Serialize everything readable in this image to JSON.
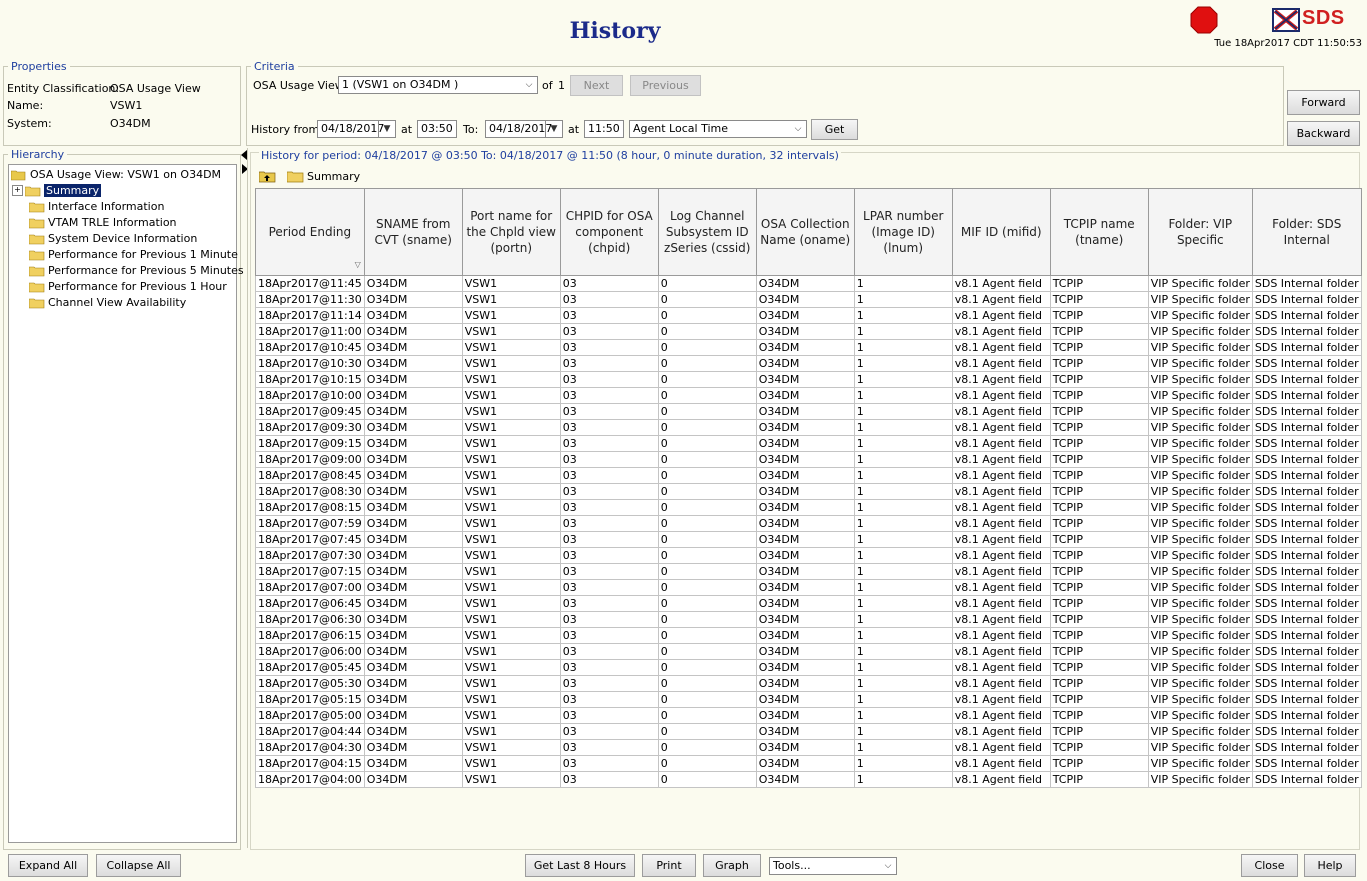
{
  "header": {
    "title": "History",
    "brand": "SDS",
    "datetime": "Tue 18Apr2017 CDT 11:50:53"
  },
  "properties": {
    "legend": "Properties",
    "rows": [
      {
        "label": "Entity Classification:",
        "value": "OSA Usage View"
      },
      {
        "label": "Name:",
        "value": "VSW1"
      },
      {
        "label": "System:",
        "value": "O34DM"
      }
    ]
  },
  "criteria": {
    "legend": "Criteria",
    "view_label": "OSA Usage View",
    "view_value": "1 (VSW1 on O34DM )",
    "of_label": "of",
    "of_count": "1",
    "next": "Next",
    "previous": "Previous",
    "history_from_label": "History from:",
    "from_date": "04/18/2017",
    "at1": "at",
    "from_time": "03:50",
    "to_label": "To:",
    "to_date": "04/18/2017",
    "at2": "at",
    "to_time": "11:50",
    "timezone": "Agent Local Time",
    "get": "Get"
  },
  "nav": {
    "forward": "Forward",
    "backward": "Backward"
  },
  "hierarchy": {
    "legend": "Hierarchy",
    "root": "OSA Usage View: VSW1 on O34DM",
    "items": [
      "Summary",
      "Interface Information",
      "VTAM TRLE Information",
      "System Device Information",
      "Performance for Previous 1 Minute",
      "Performance for Previous 5 Minutes",
      "Performance for Previous 1 Hour",
      "Channel View Availability"
    ]
  },
  "results": {
    "period_text": "History for period: 04/18/2017 @ 03:50 To: 04/18/2017 @ 11:50  (8 hour, 0 minute duration, 32 intervals)",
    "crumb": "Summary",
    "columns": [
      "Period Ending",
      "SNAME from CVT (sname)",
      "Port name for the Chpld view (portn)",
      "CHPID for OSA component (chpid)",
      "Log Channel Subsystem ID zSeries (cssid)",
      "OSA Collection Name (oname)",
      "LPAR number (Image ID) (lnum)",
      "MIF ID (mifid)",
      "TCPIP name (tname)",
      "Folder: VIP Specific",
      "Folder: SDS Internal"
    ],
    "row_values": [
      "O34DM",
      "VSW1",
      "03",
      "0",
      "O34DM",
      "1",
      "v8.1 Agent field",
      "TCPIP",
      "VIP Specific folder",
      "SDS Internal folder"
    ],
    "period_endings": [
      "18Apr2017@11:45",
      "18Apr2017@11:30",
      "18Apr2017@11:14",
      "18Apr2017@11:00",
      "18Apr2017@10:45",
      "18Apr2017@10:30",
      "18Apr2017@10:15",
      "18Apr2017@10:00",
      "18Apr2017@09:45",
      "18Apr2017@09:30",
      "18Apr2017@09:15",
      "18Apr2017@09:00",
      "18Apr2017@08:45",
      "18Apr2017@08:30",
      "18Apr2017@08:15",
      "18Apr2017@07:59",
      "18Apr2017@07:45",
      "18Apr2017@07:30",
      "18Apr2017@07:15",
      "18Apr2017@07:00",
      "18Apr2017@06:45",
      "18Apr2017@06:30",
      "18Apr2017@06:15",
      "18Apr2017@06:00",
      "18Apr2017@05:45",
      "18Apr2017@05:30",
      "18Apr2017@05:15",
      "18Apr2017@05:00",
      "18Apr2017@04:44",
      "18Apr2017@04:30",
      "18Apr2017@04:15",
      "18Apr2017@04:00"
    ]
  },
  "footer": {
    "expand_all": "Expand All",
    "collapse_all": "Collapse All",
    "get_last": "Get Last 8 Hours",
    "print": "Print",
    "graph": "Graph",
    "tools": "Tools...",
    "close": "Close",
    "help": "Help"
  }
}
